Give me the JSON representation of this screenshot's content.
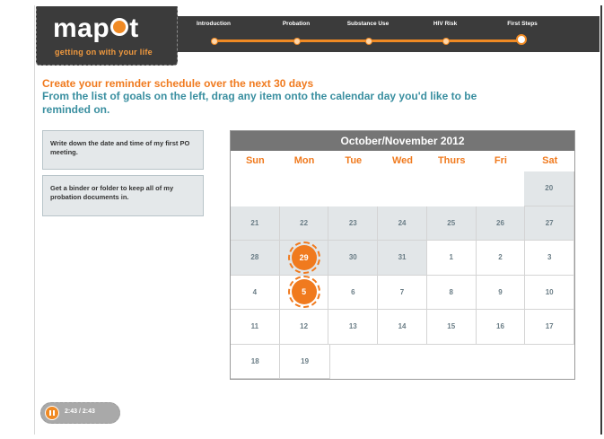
{
  "header": {
    "logo_text": "map",
    "logo_text_end": "t",
    "tagline": "getting on with your life"
  },
  "nav": {
    "steps": [
      {
        "label": "Introduction"
      },
      {
        "label": "Probation"
      },
      {
        "label": "Substance Use"
      },
      {
        "label": "HIV Risk"
      },
      {
        "label": "First Steps"
      }
    ],
    "current_step": "First Steps"
  },
  "instructions": {
    "title": "Create your reminder schedule over the next 30 days",
    "body": "From the list of goals on the left, drag any item onto the calendar day you'd like to be reminded on."
  },
  "goals": [
    {
      "text": "Write down the date and time of my first PO meeting."
    },
    {
      "text": "Get a binder or folder to keep all of my probation documents in."
    }
  ],
  "calendar": {
    "title": "October/November 2012",
    "weekdays": [
      "Sun",
      "Mon",
      "Tue",
      "Wed",
      "Thurs",
      "Fri",
      "Sat"
    ],
    "rows": [
      [
        "",
        "",
        "",
        "",
        "",
        "",
        "20"
      ],
      [
        "21",
        "22",
        "23",
        "24",
        "25",
        "26",
        "27"
      ],
      [
        "28",
        "29",
        "30",
        "31",
        "1",
        "2",
        "3"
      ],
      [
        "4",
        "5",
        "6",
        "7",
        "8",
        "9",
        "10"
      ],
      [
        "11",
        "12",
        "13",
        "14",
        "15",
        "16",
        "17"
      ],
      [
        "18",
        "19",
        "",
        "",
        "",
        "",
        ""
      ]
    ],
    "highlighted_days": [
      "29",
      "5"
    ],
    "accent_color": "#f07a1e"
  },
  "player": {
    "time": "2:43 / 2:43",
    "button_icon": "pause-icon"
  }
}
